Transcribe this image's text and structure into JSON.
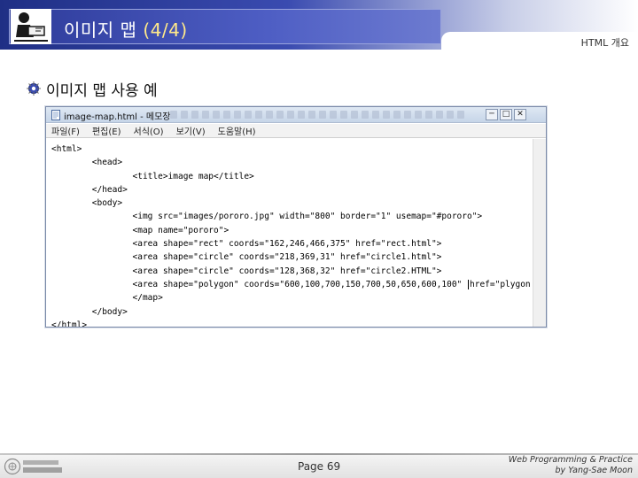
{
  "header": {
    "title_main": "이미지 맵 ",
    "title_paren": "(4/4)",
    "section": "HTML 개요"
  },
  "content": {
    "bullet": "이미지 맵 사용 예"
  },
  "notepad": {
    "window_title": "image-map.html - 메모장",
    "window_buttons": [
      "─",
      "□",
      "✕"
    ],
    "menu": [
      "파일(F)",
      "편집(E)",
      "서식(O)",
      "보기(V)",
      "도움말(H)"
    ],
    "code_lines": [
      "<html>",
      "        <head>",
      "                <title>image map</title>",
      "        </head>",
      "        <body>",
      "                <img src=\"images/pororo.jpg\" width=\"800\" border=\"1\" usemap=\"#pororo\">",
      "                <map name=\"pororo\">",
      "                <area shape=\"rect\" coords=\"162,246,466,375\" href=\"rect.html\">",
      "                <area shape=\"circle\" coords=\"218,369,31\" href=\"circle1.html\">",
      "                <area shape=\"circle\" coords=\"128,368,32\" href=\"circle2.HTML\">",
      "                <area shape=\"polygon\" coords=\"600,100,700,150,700,50,650,600,100\" ",
      "                </map>",
      "        </body>",
      "</html>"
    ],
    "caret_line_tail": "href=\"plygon.html\">"
  },
  "footer": {
    "page": "Page 69",
    "credit_line1": "Web Programming & Practice",
    "credit_line2": "by Yang-Sae Moon"
  }
}
